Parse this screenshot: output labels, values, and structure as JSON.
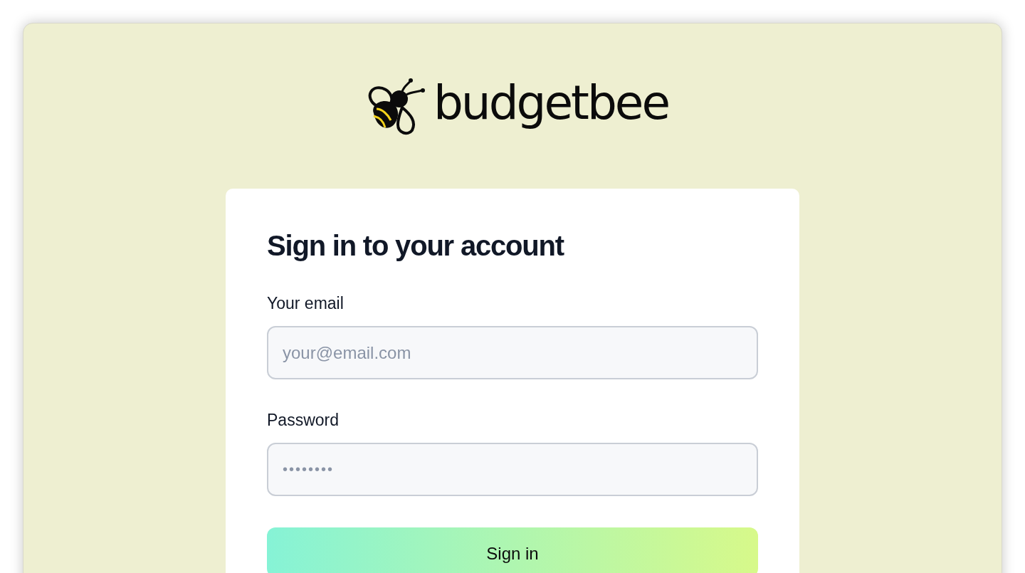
{
  "logo": {
    "text": "budgetbee"
  },
  "form": {
    "title": "Sign in to your account",
    "fields": [
      {
        "label": "Your email",
        "placeholder": "your@email.com",
        "kind": "email"
      },
      {
        "label": "Password",
        "placeholder": "••••••••",
        "kind": "password"
      }
    ],
    "submit": "Sign in"
  }
}
